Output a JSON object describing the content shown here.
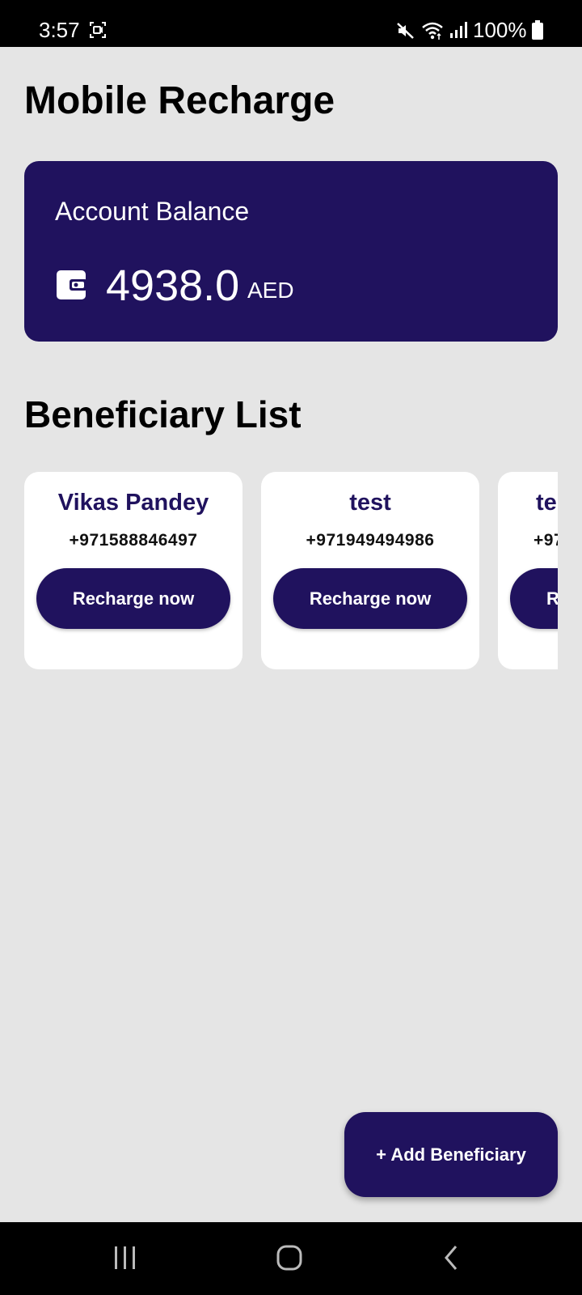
{
  "status_bar": {
    "time": "3:57",
    "battery": "100%",
    "icons": [
      "screen-record-icon",
      "mute-icon",
      "wifi-icon",
      "signal-icon",
      "battery-icon"
    ]
  },
  "page": {
    "title": "Mobile Recharge"
  },
  "balance": {
    "label": "Account Balance",
    "amount": "4938.0",
    "currency": "AED",
    "icon": "wallet-icon"
  },
  "beneficiaries": {
    "title": "Beneficiary List",
    "items": [
      {
        "name": "Vikas Pandey",
        "phone": "+971588846497",
        "button": "Recharge now"
      },
      {
        "name": "test",
        "phone": "+971949494986",
        "button": "Recharge now"
      },
      {
        "name": "te",
        "phone": "+97",
        "button": "R"
      }
    ]
  },
  "fab": {
    "label": "+ Add Beneficiary"
  },
  "nav_bar": {
    "icons": [
      "recent-apps-icon",
      "home-icon",
      "back-icon"
    ]
  },
  "colors": {
    "primary": "#20125e",
    "background": "#e5e5e5",
    "card": "#ffffff"
  }
}
